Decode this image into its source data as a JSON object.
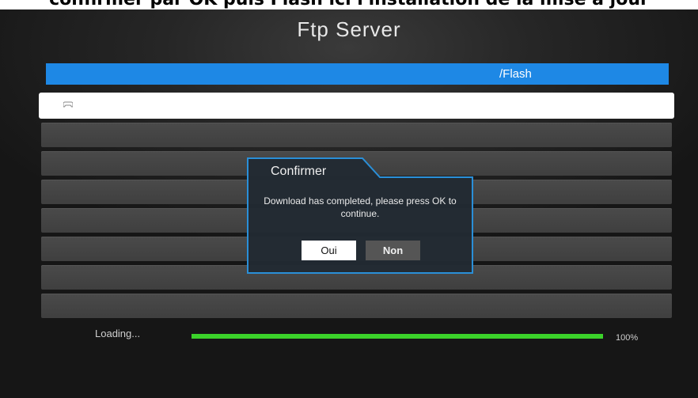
{
  "page": {
    "caption": "confirmer par OK puis Flash ici l'installation de la mise à jour",
    "title": "Ftp Server",
    "path": "/Flash"
  },
  "file_list": {
    "selected_icon": "gamepad-icon",
    "row_count": 8
  },
  "dialog": {
    "title": "Confirmer",
    "message": "Download has completed, please press OK to continue.",
    "yes_label": "Oui",
    "no_label": "Non"
  },
  "status": {
    "loading_label": "Loading...",
    "progress_percent": 100,
    "progress_text": "100%"
  },
  "colors": {
    "accent": "#1e88e5",
    "progress": "#3bd22a",
    "dialog_border": "#2a8fd8"
  }
}
